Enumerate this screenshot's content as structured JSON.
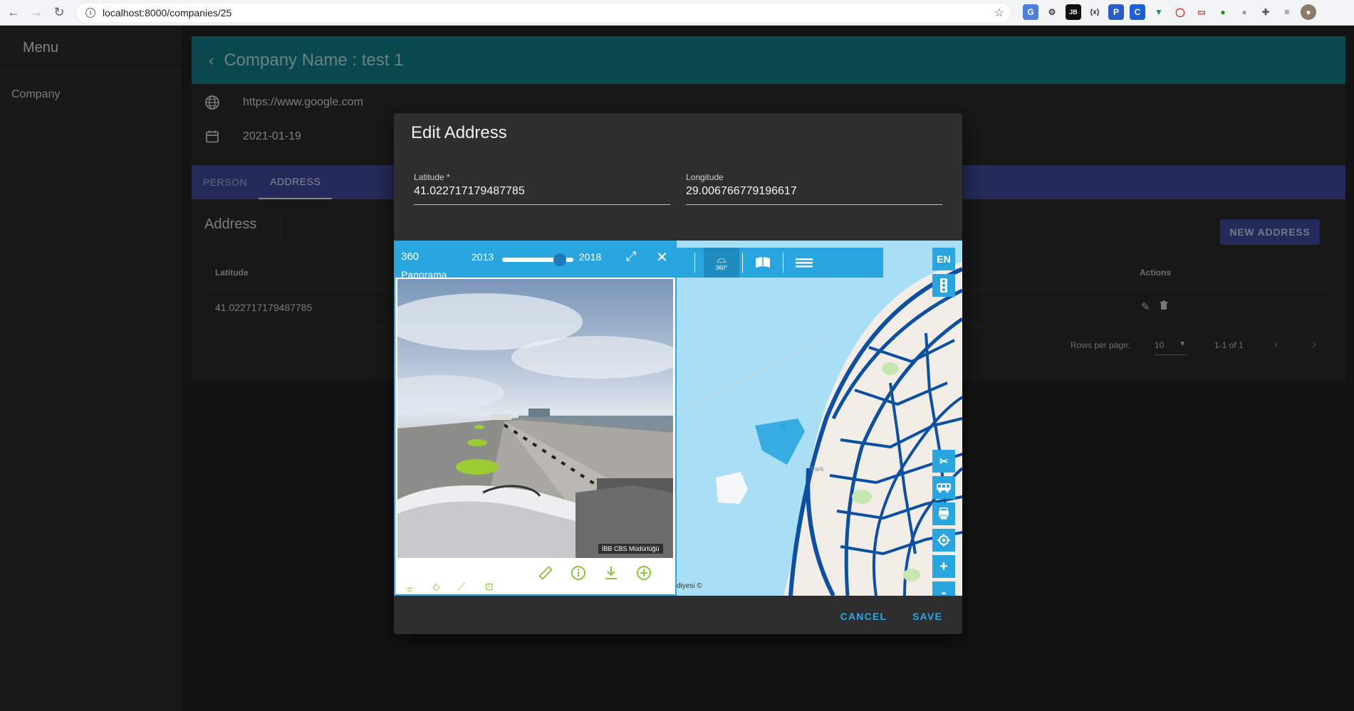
{
  "browser": {
    "url": "localhost:8000/companies/25"
  },
  "sidebar": {
    "title": "Menu",
    "items": [
      {
        "label": "Company"
      }
    ]
  },
  "header": {
    "title": "Company Name : test 1"
  },
  "company_info": {
    "website": "https://www.google.com",
    "date": "2021-01-19"
  },
  "tabs": [
    {
      "label": "PERSON",
      "active": false
    },
    {
      "label": "ADDRESS",
      "active": true
    }
  ],
  "address_card": {
    "title": "Address",
    "new_button": "NEW ADDRESS",
    "columns": {
      "latitude": "Latitude",
      "actions": "Actions"
    },
    "rows": [
      {
        "latitude": "41.022717179487785"
      }
    ],
    "pagination": {
      "rows_per_page_label": "Rows per page:",
      "rows_per_page_value": "10",
      "range": "1-1 of 1"
    }
  },
  "dialog": {
    "title": "Edit Address",
    "latitude": {
      "label": "Latitude *",
      "value": "41.022717179487785"
    },
    "longitude": {
      "label": "Longitude",
      "value": "29.006766779196617"
    },
    "cancel_label": "CANCEL",
    "save_label": "SAVE"
  },
  "map": {
    "panorama": {
      "label_top": "360",
      "label_bottom": "Panorama",
      "year_start": "2013",
      "year_end": "2018",
      "year_slider_fraction": 0.82,
      "credit": "İBB CBS Müdürlüğü"
    },
    "lang_button": "EN",
    "park_label": "Park",
    "copyright": "diyesi ©",
    "toolbar_360": "360°",
    "zoom_in": "+",
    "zoom_out": "-",
    "accent_color": "#29a6df",
    "road_color": "#0d4fa3",
    "water_color": "#a8dff7"
  },
  "colors": {
    "header": "#117f86",
    "tabs": "#3f4a9c",
    "dialog_button": "#2ea6e6"
  }
}
